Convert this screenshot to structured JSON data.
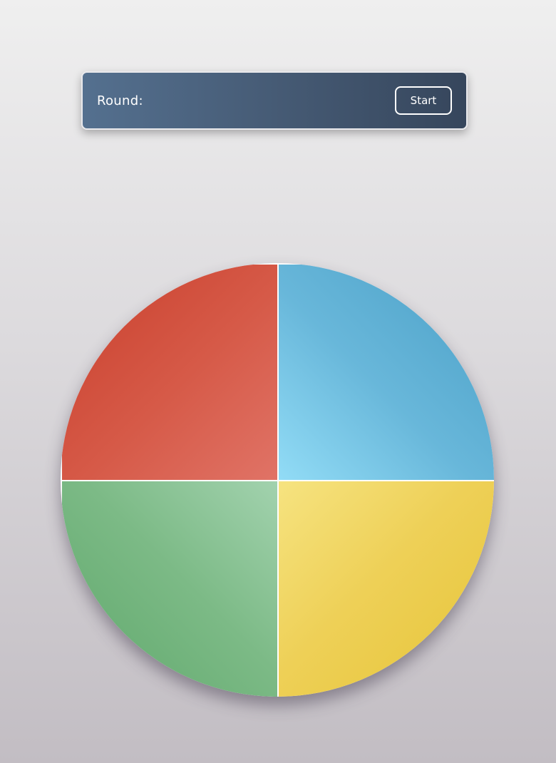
{
  "panel": {
    "round_label": "Round:",
    "round_value": "",
    "start_label": "Start"
  },
  "pads": [
    {
      "name": "red",
      "color": "#d65a48"
    },
    {
      "name": "blue",
      "color": "#68b7da"
    },
    {
      "name": "green",
      "color": "#7cba86"
    },
    {
      "name": "yellow",
      "color": "#eed057"
    }
  ]
}
